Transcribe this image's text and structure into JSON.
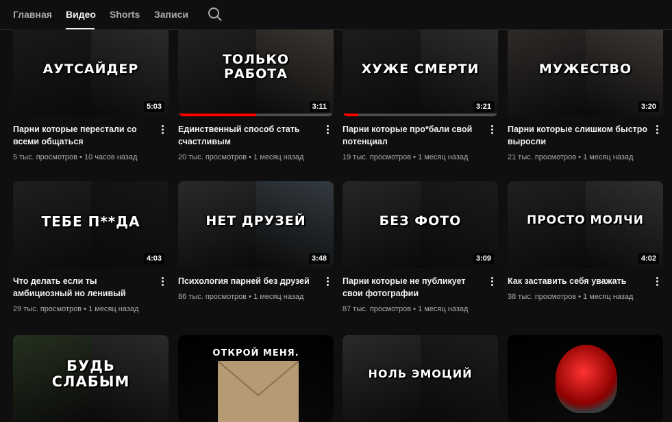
{
  "tabs": [
    {
      "label": "Главная",
      "active": false
    },
    {
      "label": "Видео",
      "active": true
    },
    {
      "label": "Shorts",
      "active": false
    },
    {
      "label": "Записи",
      "active": false
    }
  ],
  "colors": {
    "background": "#0f0f0f",
    "accent": "#ff0000",
    "text": "#f1f1f1",
    "muted": "#aaaaaa"
  },
  "videos": [
    {
      "overlay": "АУТСАЙДЕР",
      "duration": "5:03",
      "title": "Парни которые перестали со всеми общаться",
      "views": "5 тыс. просмотров",
      "date": "10 часов назад",
      "watched": 0
    },
    {
      "overlay": "ТОЛЬКО\nРАБОТА",
      "duration": "3:11",
      "title": "Единственный способ стать счастливым",
      "views": "20 тыс. просмотров",
      "date": "1 месяц назад",
      "watched": 0.5
    },
    {
      "overlay": "ХУЖЕ СМЕРТИ",
      "duration": "3:21",
      "title": "Парни которые про*бали свой потенциал",
      "views": "19 тыс. просмотров",
      "date": "1 месяц назад",
      "watched": 0.1
    },
    {
      "overlay": "МУЖЕСТВО",
      "duration": "3:20",
      "title": "Парни которые слишком быстро выросли",
      "views": "21 тыс. просмотров",
      "date": "1 месяц назад",
      "watched": 0
    },
    {
      "overlay": "ТЕБЕ П**ДА",
      "duration": "4:03",
      "title": "Что делать если ты амбициозный но ленивый",
      "views": "29 тыс. просмотров",
      "date": "1 месяц назад",
      "watched": 0
    },
    {
      "overlay": "НЕТ ДРУЗЕЙ",
      "duration": "3:48",
      "title": "Психология парней без друзей",
      "views": "86 тыс. просмотров",
      "date": "1 месяц назад",
      "watched": 0
    },
    {
      "overlay": "БЕЗ ФОТО",
      "duration": "3:09",
      "title": "Парни которые не публикует свои фотографии",
      "views": "87 тыс. просмотров",
      "date": "1 месяц назад",
      "watched": 0
    },
    {
      "overlay": "ПРОСТО МОЛЧИ",
      "duration": "4:02",
      "title": "Как заставить себя уважать",
      "views": "38 тыс. просмотров",
      "date": "1 месяц назад",
      "watched": 0
    },
    {
      "overlay": "БУДЬ\nСЛАБЫМ",
      "duration": "",
      "title": "",
      "views": "",
      "date": "",
      "watched": 0
    },
    {
      "overlay": "ОТКРОЙ МЕНЯ.",
      "duration": "",
      "title": "",
      "views": "",
      "date": "",
      "watched": 0
    },
    {
      "overlay": "НОЛЬ ЭМОЦИЙ",
      "duration": "",
      "title": "",
      "views": "",
      "date": "",
      "watched": 0
    },
    {
      "overlay": "",
      "duration": "",
      "title": "",
      "views": "",
      "date": "",
      "watched": 0
    }
  ]
}
